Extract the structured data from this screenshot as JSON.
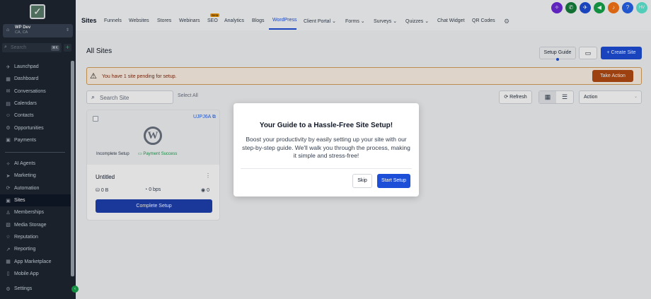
{
  "sidebar": {
    "account": {
      "name": "WP Dev",
      "location": "CA, CA"
    },
    "search": {
      "placeholder": "Search",
      "shortcut": "⌘K"
    },
    "items_top": [
      {
        "label": "Launchpad",
        "icon": "rocket-icon",
        "glyph": "✈"
      },
      {
        "label": "Dashboard",
        "icon": "dashboard-icon",
        "glyph": "▦"
      },
      {
        "label": "Conversations",
        "icon": "chat-icon",
        "glyph": "✉"
      },
      {
        "label": "Calendars",
        "icon": "calendar-icon",
        "glyph": "▤"
      },
      {
        "label": "Contacts",
        "icon": "contacts-icon",
        "glyph": "☺"
      },
      {
        "label": "Opportunities",
        "icon": "funnel-icon",
        "glyph": "⚙"
      },
      {
        "label": "Payments",
        "icon": "payments-icon",
        "glyph": "▣"
      }
    ],
    "items_bottom": [
      {
        "label": "AI Agents",
        "icon": "ai-icon",
        "glyph": "✧"
      },
      {
        "label": "Marketing",
        "icon": "send-icon",
        "glyph": "➤"
      },
      {
        "label": "Automation",
        "icon": "automation-icon",
        "glyph": "⟳"
      },
      {
        "label": "Sites",
        "icon": "sites-icon",
        "glyph": "▣"
      },
      {
        "label": "Memberships",
        "icon": "membership-icon",
        "glyph": "♙"
      },
      {
        "label": "Media Storage",
        "icon": "media-icon",
        "glyph": "▧"
      },
      {
        "label": "Reputation",
        "icon": "star-icon",
        "glyph": "☆"
      },
      {
        "label": "Reporting",
        "icon": "chart-icon",
        "glyph": "↗"
      },
      {
        "label": "App Marketplace",
        "icon": "grid-icon",
        "glyph": "▦"
      },
      {
        "label": "Mobile App",
        "icon": "mobile-icon",
        "glyph": "▯"
      }
    ],
    "settings_label": "Settings",
    "active": "Sites"
  },
  "topnav": {
    "page": "Sites",
    "beta": "Beta",
    "tabs": [
      "Funnels",
      "Websites",
      "Stores",
      "Webinars",
      "SEO",
      "Analytics",
      "Blogs",
      "WordPress",
      "Client Portal",
      "Forms",
      "Surveys",
      "Quizzes",
      "Chat Widget",
      "QR Codes"
    ],
    "avatar_initials": "HV"
  },
  "main": {
    "title": "All Sites",
    "setup_guide": "Setup Guide",
    "create_site": "Create Site",
    "alert_text": "You have 1 site pending for setup.",
    "take_action": "Take Action",
    "search_placeholder": "Search Site",
    "select_all": "Select All",
    "refresh": "Refresh",
    "action": "Action"
  },
  "card": {
    "id": "UJPJ6A",
    "status": "Incomplete Setup",
    "payment": "Payment Success",
    "name": "Untitled",
    "storage": "0 B",
    "bandwidth": "0 bps",
    "views": "0",
    "button": "Complete Setup"
  },
  "modal": {
    "title": "Your Guide to a Hassle-Free Site Setup!",
    "body": "Boost your productivity by easily setting up your site with our step-by-step guide. We'll walk you through the process, making it simple and stress-free!",
    "skip": "Skip",
    "start": "Start Setup"
  },
  "colors": {
    "primary": "#1d4ed8",
    "sidebar": "#1e2631",
    "alert_bg": "#fdf2e6",
    "take_action": "#b24a12",
    "success": "#16a34a"
  }
}
